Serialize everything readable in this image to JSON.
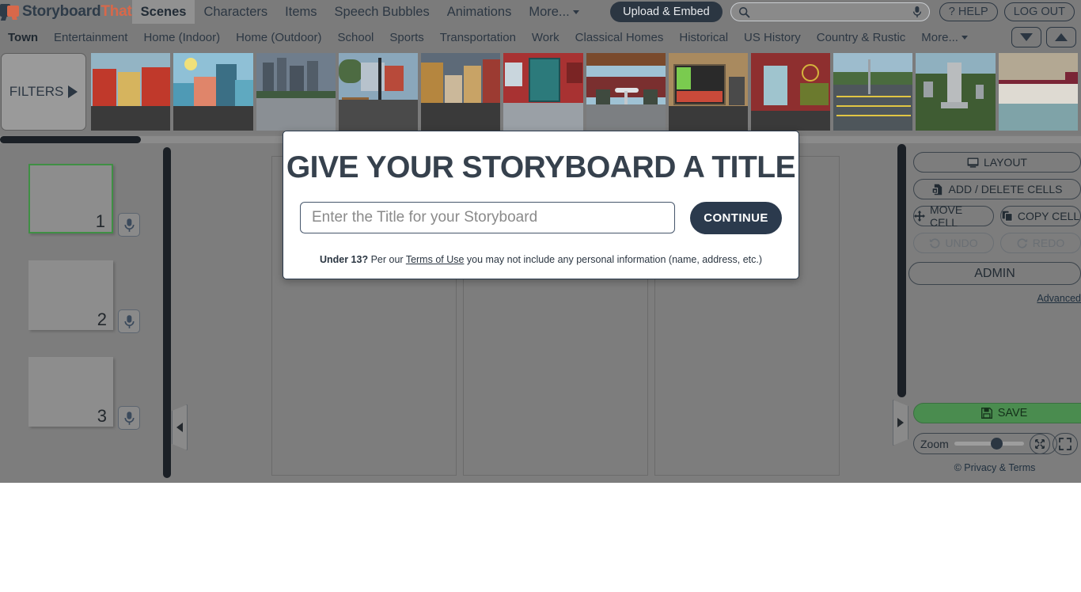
{
  "brand": {
    "name_part1": "Storyboard",
    "name_part2": "That",
    "accent": "#d8684a",
    "dark": "#2e3b48"
  },
  "topnav": {
    "items": [
      {
        "label": "Scenes",
        "active": true
      },
      {
        "label": "Characters",
        "active": false
      },
      {
        "label": "Items",
        "active": false
      },
      {
        "label": "Speech Bubbles",
        "active": false
      },
      {
        "label": "Animations",
        "active": false
      },
      {
        "label": "More...",
        "active": false,
        "caret": true
      }
    ],
    "upload_label": "Upload & Embed",
    "search_placeholder": "",
    "search_value": "",
    "help_label": "? HELP",
    "logout_label": "LOG OUT"
  },
  "categories": {
    "items": [
      {
        "label": "Town",
        "active": true
      },
      {
        "label": "Entertainment",
        "active": false
      },
      {
        "label": "Home (Indoor)",
        "active": false
      },
      {
        "label": "Home (Outdoor)",
        "active": false
      },
      {
        "label": "School",
        "active": false
      },
      {
        "label": "Sports",
        "active": false
      },
      {
        "label": "Transportation",
        "active": false
      },
      {
        "label": "Work",
        "active": false
      },
      {
        "label": "Classical Homes",
        "active": false
      },
      {
        "label": "Historical",
        "active": false
      },
      {
        "label": "US History",
        "active": false
      },
      {
        "label": "Country & Rustic",
        "active": false
      },
      {
        "label": "More...",
        "active": false,
        "caret": true
      }
    ]
  },
  "strip": {
    "filters_label": "FILTERS",
    "thumbnails": [
      {
        "name": "city-apartments",
        "sky": "#93b4c4",
        "ground": "#3d3d3d",
        "accent": "#c0392b"
      },
      {
        "name": "town-shops-daytime",
        "sky": "#8fc0d6",
        "ground": "#3a3a3a",
        "accent": "#e07a5f"
      },
      {
        "name": "city-skyline-park",
        "sky": "#6f7d8c",
        "ground": "#8a8f94",
        "accent": "#4a5a4a"
      },
      {
        "name": "street-bench-lamp",
        "sky": "#8aa7bb",
        "ground": "#4a4a4a",
        "accent": "#8c6239"
      },
      {
        "name": "city-street-corner",
        "sky": "#5d6a78",
        "ground": "#3a3a3a",
        "accent": "#b5863f"
      },
      {
        "name": "red-brick-front-door",
        "sky": "#a83232",
        "ground": "#9aa0a6",
        "accent": "#2c7a7b"
      },
      {
        "name": "restaurant-patio",
        "sky": "#9fc2d4",
        "ground": "#7c7f82",
        "accent": "#7a2f2f"
      },
      {
        "name": "convenience-store-counter",
        "sky": "#a98a5f",
        "ground": "#3a3a3a",
        "accent": "#2a2a2a"
      },
      {
        "name": "back-alley-door",
        "sky": "#8e2f2f",
        "ground": "#3a3a3a",
        "accent": "#d4b43c"
      },
      {
        "name": "parking-lot",
        "sky": "#9dbccd",
        "ground": "#4e565b",
        "accent": "#e0c543"
      },
      {
        "name": "cemetery-statue",
        "sky": "#8fb0bf",
        "ground": "#3f5c33",
        "accent": "#b9bcbe"
      },
      {
        "name": "indoor-counter",
        "sky": "#b3a893",
        "ground": "#7fa3a8",
        "accent": "#7a2536"
      }
    ]
  },
  "cells": {
    "items": [
      {
        "number": "1",
        "selected": true
      },
      {
        "number": "2",
        "selected": false
      },
      {
        "number": "3",
        "selected": false
      }
    ]
  },
  "toolbar": {
    "layout_label": "LAYOUT",
    "add_delete_label": "ADD / DELETE CELLS",
    "move_cell_label": "MOVE CELL",
    "copy_cell_label": "COPY CELL",
    "undo_label": "UNDO",
    "redo_label": "REDO",
    "admin_label": "ADMIN",
    "advanced_label": "Advanced",
    "save_label": "SAVE",
    "save_color": "#4a8c4f",
    "zoom_label": "Zoom",
    "zoom_value": "52",
    "privacy_label": "© Privacy & Terms"
  },
  "modal": {
    "title": "GIVE YOUR STORYBOARD A TITLE",
    "input_placeholder": "Enter the Title for your Storyboard",
    "input_value": "",
    "continue_label": "CONTINUE",
    "note_prefix": "Under 13?",
    "note_mid": " Per our ",
    "note_link": "Terms of Use",
    "note_suffix": " you may not include any personal information (name, address, etc.)"
  }
}
